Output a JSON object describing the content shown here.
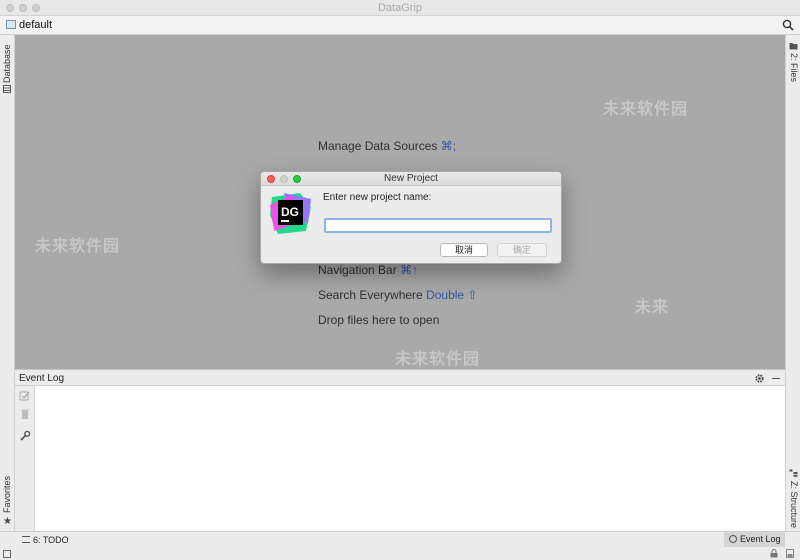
{
  "window": {
    "title": "DataGrip"
  },
  "navbar": {
    "project": "default"
  },
  "sidebar": {
    "left_top": "1: Database",
    "left_bottom": "Favorites",
    "right_top": "2: Files",
    "right_bottom": "Z: Structure"
  },
  "welcome": {
    "items": [
      {
        "label": "Manage Data Sources",
        "shortcut": "⌘;"
      },
      {
        "label": "Navigation Bar",
        "shortcut": "⌘↑"
      },
      {
        "label": "Search Everywhere",
        "shortcut": "Double ⇧"
      },
      {
        "label": "Drop files here to open",
        "shortcut": ""
      }
    ]
  },
  "dialog": {
    "title": "New Project",
    "prompt": "Enter new project name:",
    "input_value": "",
    "cancel": "取消",
    "ok": "确定",
    "logo_text": "DG"
  },
  "event_log": {
    "title": "Event Log"
  },
  "statusbar": {
    "todo": "6: TODO",
    "event_log_tab": "Event Log"
  },
  "watermarks": [
    "未来软件园",
    "未来软件园",
    "未来软件园",
    "未来"
  ],
  "colors": {
    "shortcut": "#3057a8",
    "input_focus": "#8db3e2"
  }
}
